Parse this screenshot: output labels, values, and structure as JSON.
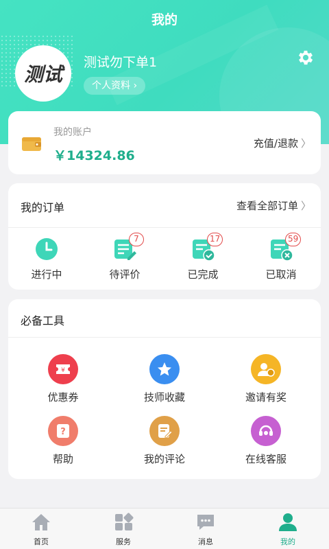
{
  "title": "我的",
  "profile": {
    "avatar_text": "测试",
    "username": "测试勿下单1",
    "profile_button": "个人资料"
  },
  "account": {
    "label": "我的账户",
    "amount": "￥14324.86",
    "recharge": "充值/退款"
  },
  "orders": {
    "title": "我的订单",
    "view_all": "查看全部订单",
    "items": [
      {
        "label": "进行中",
        "badge": ""
      },
      {
        "label": "待评价",
        "badge": "7"
      },
      {
        "label": "已完成",
        "badge": "17"
      },
      {
        "label": "已取消",
        "badge": "59"
      }
    ]
  },
  "tools": {
    "title": "必备工具",
    "items": [
      {
        "label": "优惠券",
        "icon": "coupon-icon",
        "color": "#ee3f4d"
      },
      {
        "label": "技师收藏",
        "icon": "star-icon",
        "color": "#3a8ef0"
      },
      {
        "label": "邀请有奖",
        "icon": "invite-icon",
        "color": "#f5b526"
      },
      {
        "label": "帮助",
        "icon": "help-icon",
        "color": "#f07d6b"
      },
      {
        "label": "我的评论",
        "icon": "comment-icon",
        "color": "#e0a048"
      },
      {
        "label": "在线客服",
        "icon": "service-icon",
        "color": "#c660d1"
      }
    ]
  },
  "tabbar": [
    {
      "label": "首页",
      "icon": "home-icon"
    },
    {
      "label": "服务",
      "icon": "grid-icon"
    },
    {
      "label": "消息",
      "icon": "message-icon"
    },
    {
      "label": "我的",
      "icon": "user-icon",
      "active": true
    }
  ],
  "colors": {
    "accent": "#42e0c0",
    "amount": "#1fae8c",
    "badge": "#e24a4a"
  }
}
